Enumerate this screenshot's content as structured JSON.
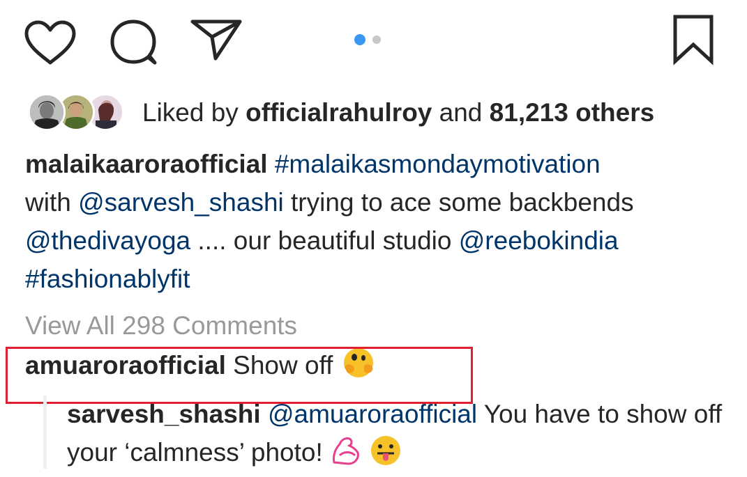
{
  "actions": {
    "like_icon": "heart-outline-icon",
    "comment_icon": "speech-bubble-icon",
    "share_icon": "paper-plane-icon",
    "save_icon": "bookmark-outline-icon",
    "carousel": {
      "total": 2,
      "active": 1
    }
  },
  "likes": {
    "prefix": "Liked by",
    "user": "officialrahulroy",
    "conjunction": "and",
    "count": "81,213 others"
  },
  "caption": {
    "author": "malaikaaroraofficial",
    "hashtag_1": "#malaikasmondaymotivation",
    "text_1": "with",
    "mention_1": "@sarvesh_shashi",
    "text_2": "trying to ace some backbends",
    "mention_2": "@thedivayoga",
    "text_3": ".... our beautiful studio",
    "mention_3": "@reebokindia",
    "hashtag_2": "#fashionablyfit"
  },
  "view_all": "View All 298 Comments",
  "comment": {
    "author": "amuaroraofficial",
    "text": "Show off",
    "emoji": "hugging-face-emoji"
  },
  "reply": {
    "author": "sarvesh_shashi",
    "mention": "@amuaroraofficial",
    "text": "You have to show off your ‘calmness’ photo!",
    "emoji_1": "flexed-biceps-emoji",
    "emoji_2": "tongue-out-face-emoji"
  },
  "colors": {
    "text": "#262626",
    "link": "#003569",
    "muted": "#999999",
    "carousel_active": "#3897f0",
    "highlight": "#e0202e"
  }
}
